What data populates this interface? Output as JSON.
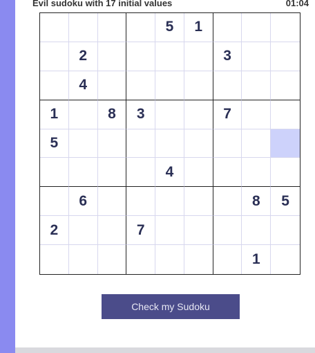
{
  "header": {
    "title": "Evil sudoku with 17 initial values",
    "timer": "01:04"
  },
  "board": {
    "cells": [
      [
        "",
        "",
        "",
        "",
        "5",
        "1",
        "",
        "",
        ""
      ],
      [
        "",
        "2",
        "",
        "",
        "",
        "",
        "3",
        "",
        ""
      ],
      [
        "",
        "4",
        "",
        "",
        "",
        "",
        "",
        "",
        ""
      ],
      [
        "1",
        "",
        "8",
        "3",
        "",
        "",
        "7",
        "",
        ""
      ],
      [
        "5",
        "",
        "",
        "",
        "",
        "",
        "",
        "",
        ""
      ],
      [
        "",
        "",
        "",
        "",
        "4",
        "",
        "",
        "",
        ""
      ],
      [
        "",
        "6",
        "",
        "",
        "",
        "",
        "",
        "8",
        "5"
      ],
      [
        "2",
        "",
        "",
        "7",
        "",
        "",
        "",
        "",
        ""
      ],
      [
        "",
        "",
        "",
        "",
        "",
        "",
        "",
        "1",
        ""
      ]
    ],
    "selected_cell": {
      "row": 5,
      "col": 9
    }
  },
  "actions": {
    "check_label": "Check my Sudoku"
  }
}
